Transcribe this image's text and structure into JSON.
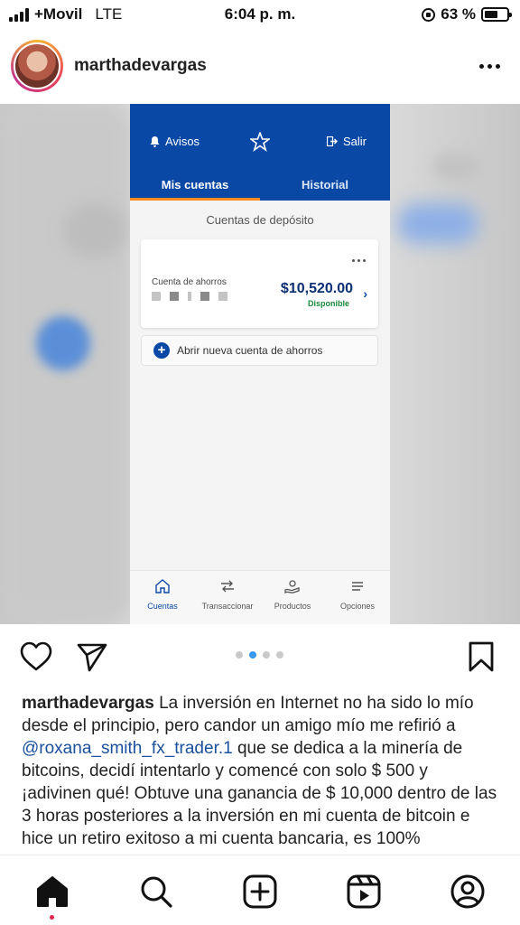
{
  "status_bar": {
    "carrier": "+Movil",
    "network": "LTE",
    "time": "6:04 p. m.",
    "battery": "63 %",
    "battery_level": 0.63
  },
  "post": {
    "username": "marthadevargas"
  },
  "bank_app": {
    "avisos": "Avisos",
    "salir": "Salir",
    "tabs": [
      "Mis cuentas",
      "Historial"
    ],
    "section_title": "Cuentas de depósito",
    "account": {
      "label": "Cuenta de ahorros",
      "amount": "$10,520.00",
      "status": "Disponible"
    },
    "open_account": "Abrir nueva cuenta de ahorros",
    "nav": [
      {
        "label": "Cuentas",
        "icon": "home-icon"
      },
      {
        "label": "Transaccionar",
        "icon": "transfer-icon"
      },
      {
        "label": "Productos",
        "icon": "products-icon"
      },
      {
        "label": "Opciones",
        "icon": "menu-icon"
      }
    ],
    "colors": {
      "header": "#0a48a6",
      "accent": "#ff8a1f",
      "available": "#1a8a3a"
    }
  },
  "carousel": {
    "count": 4,
    "active_index": 1
  },
  "caption": {
    "username": "marthadevargas",
    "text_before": " La inversión en Internet no ha sido lo mío desde el principio, pero candor un amigo mío me refirió a ",
    "mention": "@roxana_smith_fx_trader.1",
    "text_after": " que se dedica a la minería de bitcoins, decidí intentarlo y comencé con solo $ 500 y ¡adivinen qué!  Obtuve una ganancia de $ 10,000 dentro de las 3 horas posteriores a la inversión en mi cuenta de bitcoin e hice un retiro exitoso a mi cuenta bancaria, es 100%"
  },
  "bottom_nav": [
    "home-icon",
    "search-icon",
    "create-icon",
    "reels-icon",
    "profile-icon"
  ]
}
